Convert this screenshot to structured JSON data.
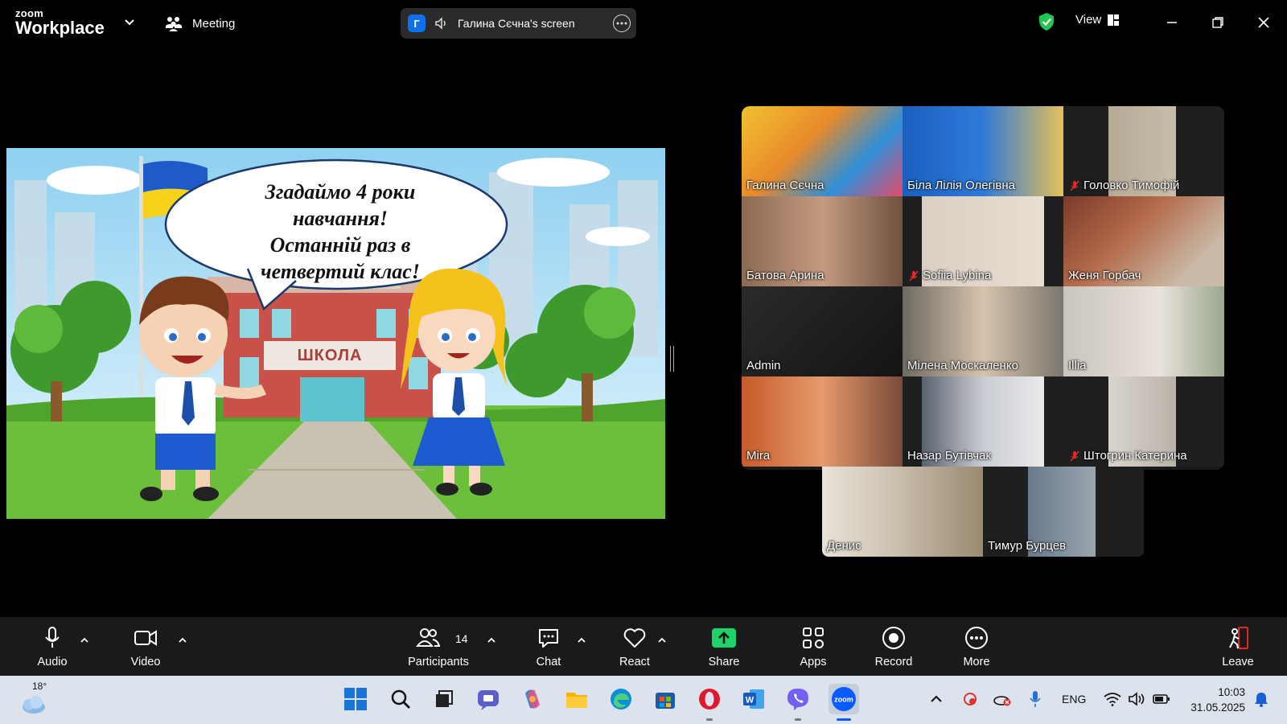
{
  "app": {
    "logo_small": "zoom",
    "logo_big": "Workplace",
    "meeting_label": "Meeting",
    "share_avatar_letter": "Г",
    "share_title": "Галина Сєчна's screen",
    "view_label": "View"
  },
  "slide": {
    "bubble_lines": [
      "Згадаймо 4 роки",
      "навчання!",
      "Останній раз в",
      "четвертий клас!"
    ],
    "school_sign": "ШКОЛА"
  },
  "gallery": {
    "participants": [
      {
        "name": "Галина Сєчна",
        "muted": false
      },
      {
        "name": "Біла Лілія Олегівна",
        "muted": false
      },
      {
        "name": "Головко Тимофій",
        "muted": true
      },
      {
        "name": "Батова Арина",
        "muted": false
      },
      {
        "name": "Sofiia Lybina",
        "muted": true
      },
      {
        "name": "Женя Горбач",
        "muted": false
      },
      {
        "name": "Admin",
        "muted": false
      },
      {
        "name": "Мілена Москаленко",
        "muted": false
      },
      {
        "name": "Illia",
        "muted": false
      },
      {
        "name": "Mira",
        "muted": false
      },
      {
        "name": "Назар Бутівчак",
        "muted": false
      },
      {
        "name": "Штогрин Катерина",
        "muted": true
      },
      {
        "name": "Денис",
        "muted": false
      },
      {
        "name": "Тимур Бурцев",
        "muted": false,
        "active_speaker": true
      }
    ]
  },
  "toolbar": {
    "audio": "Audio",
    "video": "Video",
    "participants": "Participants",
    "participant_count": "14",
    "chat": "Chat",
    "react": "React",
    "share": "Share",
    "apps": "Apps",
    "record": "Record",
    "more": "More",
    "leave": "Leave"
  },
  "taskbar": {
    "temperature": "18°",
    "language": "ENG",
    "time": "10:03",
    "date": "31.05.2025"
  },
  "colors": {
    "share_green": "#1fd36b",
    "active_speaker_border": "#23d96b",
    "zoom_blue": "#0e71eb",
    "leave_red": "#e02828"
  }
}
